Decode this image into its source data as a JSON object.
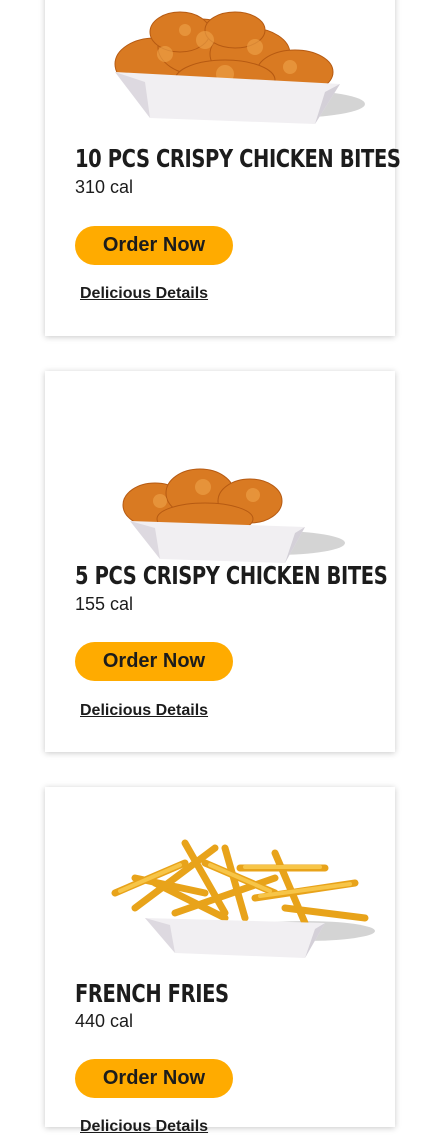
{
  "menu": {
    "items": [
      {
        "name": "10 PCS CRISPY CHICKEN BITES",
        "calories": "310 cal",
        "order_label": "Order Now",
        "details_label": "Delicious Details",
        "image": "chicken-bites-large-image"
      },
      {
        "name": "5 PCS CRISPY CHICKEN BITES",
        "calories": "155 cal",
        "order_label": "Order Now",
        "details_label": "Delicious Details",
        "image": "chicken-bites-small-image"
      },
      {
        "name": "FRENCH FRIES",
        "calories": "440 cal",
        "order_label": "Order Now",
        "details_label": "Delicious Details",
        "image": "french-fries-image"
      }
    ]
  },
  "colors": {
    "order_button": "#ffab00",
    "text": "#1c1c1c",
    "card_background": "#ffffff"
  }
}
